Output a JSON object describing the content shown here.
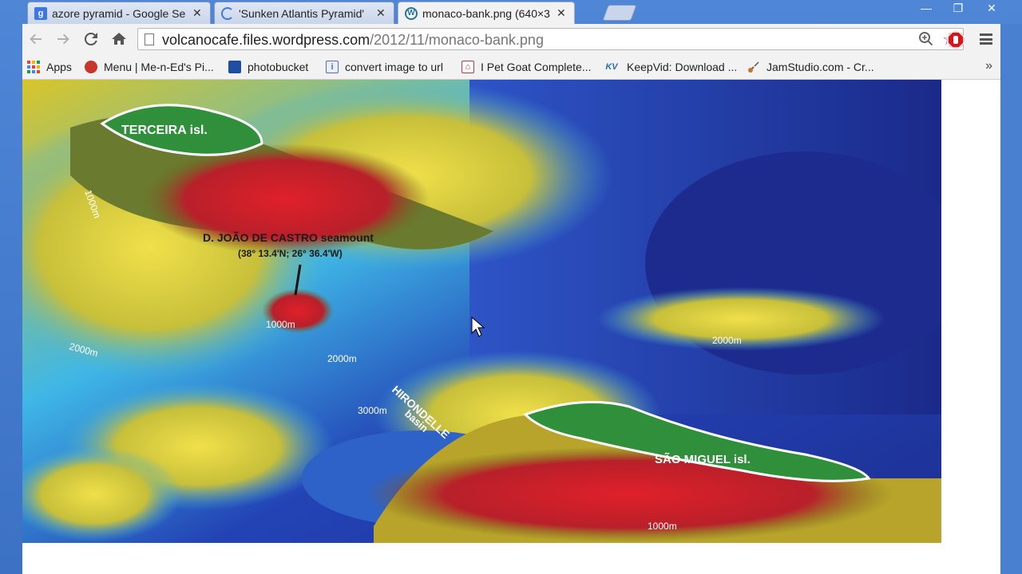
{
  "tabs": [
    {
      "title": "azore pyramid - Google Se",
      "icon": "google-icon",
      "active": false
    },
    {
      "title": "'Sunken Atlantis Pyramid'",
      "icon": "loading-icon",
      "active": false
    },
    {
      "title": "monaco-bank.png (640×3",
      "icon": "wordpress-icon",
      "active": true
    }
  ],
  "close_glyph": "✕",
  "window_controls": {
    "minimize": "—",
    "restore": "❐",
    "close": "✕"
  },
  "address": {
    "host": "volcanocafe.files.wordpress.com",
    "path": "/2012/11/monaco-bank.png"
  },
  "bookmarks": [
    {
      "label": "Apps",
      "icon": "apps-grid-icon"
    },
    {
      "label": "Menu | Me-n-Ed's Pi...",
      "icon": "restaurant-icon"
    },
    {
      "label": "photobucket",
      "icon": "photobucket-icon"
    },
    {
      "label": "convert image to url",
      "icon": "document-icon"
    },
    {
      "label": "I Pet Goat Complete...",
      "icon": "pdf-icon"
    },
    {
      "label": "KeepVid: Download ...",
      "icon": "keepvid-icon",
      "badge": "KV"
    },
    {
      "label": "JamStudio.com - Cr...",
      "icon": "guitar-icon"
    }
  ],
  "bookmarks_more": "»",
  "map": {
    "labels": {
      "terceira": "TERCEIRA isl.",
      "castro": "D. JOÃO DE CASTRO seamount",
      "coords": "(38° 13.4'N; 26° 36.4'W)",
      "hirondelle": "HIRONDELLE",
      "basin": "basin",
      "miguel": "SÃO MIGUEL isl."
    },
    "depths": [
      "1000m",
      "1000m",
      "2000m",
      "2000m",
      "2000m",
      "3000m",
      "1000m"
    ]
  },
  "colors": {
    "frame": "#4f86d6",
    "toolbar": "#f2f2f2",
    "ext_red": "#d4161d"
  }
}
